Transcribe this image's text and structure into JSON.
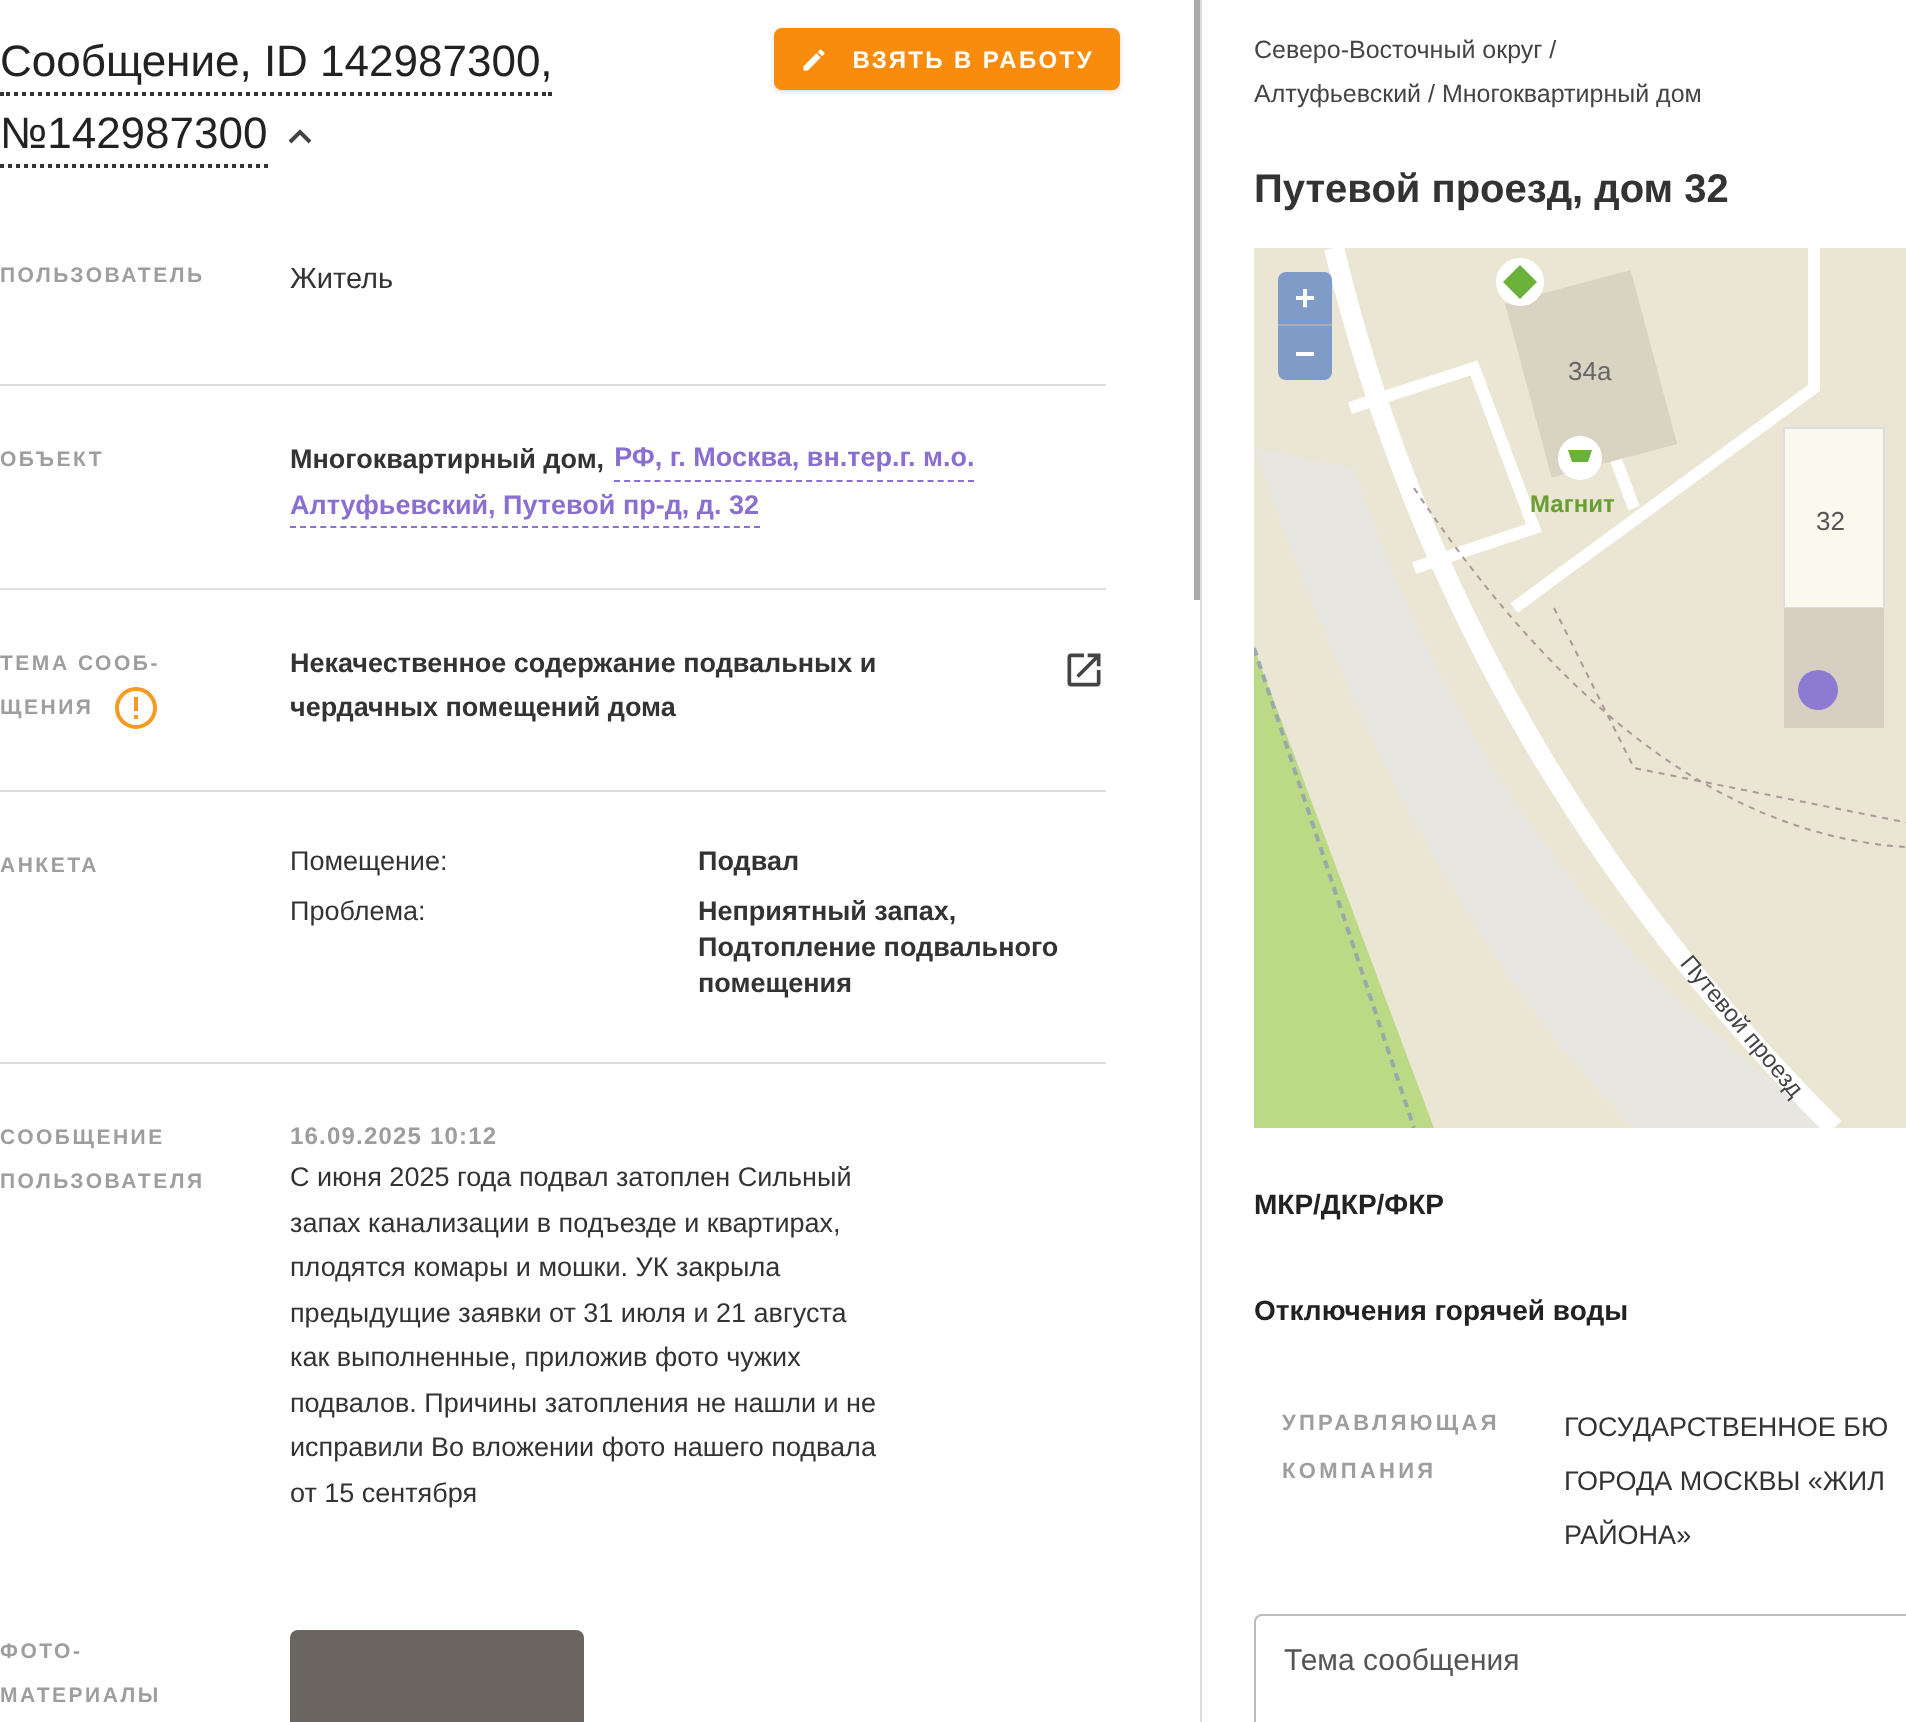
{
  "header": {
    "title_line1": "Сообщение, ID 142987300,",
    "title_line2": "№142987300",
    "expanded": true,
    "action_button": "ВЗЯТЬ В РАБОТУ"
  },
  "fields": [
    {
      "kind": "text",
      "label": [
        "ПОЛЬЗОВАТЕЛЬ"
      ],
      "value": "Житель",
      "divider": false
    },
    {
      "kind": "object",
      "label": [
        "ОБЪЕКТ"
      ],
      "value": "Многоквартирный дом,",
      "link": [
        "РФ, г. Москва, вн.тер.г. м.о.",
        "Алтуфьевский, Путевой пр-д, д. 32"
      ],
      "divider": true
    },
    {
      "kind": "topic",
      "label": [
        "ТЕМА СООБ-",
        "ЩЕНИЯ"
      ],
      "value": "Некачественное содержание подвальных и чердачных помещений дома",
      "warning": true,
      "divider": true
    },
    {
      "kind": "survey",
      "label": [
        "АНКЕТА"
      ],
      "items": [
        {
          "key": "Помещение:",
          "value": "Подвал"
        },
        {
          "key": "Проблема:",
          "value": "Неприятный запах, Подтопление подвального помещения"
        }
      ],
      "divider": true
    },
    {
      "kind": "message",
      "label": [
        "СООБЩЕНИЕ",
        "ПОЛЬЗОВАТЕЛЯ"
      ],
      "date": "16.09.2025 10:12",
      "value": "С июня 2025 года подвал затоплен Сильный запах канализации в подъезде и квартирах, плодятся комары и мошки. УК закрыла предыдущие заявки от 31 июля и 21 августа как выполненные, приложив фото чужих подвалов. Причины затопления не нашли и не исправили Во вложении фото нашего подвала от 15 сентября",
      "divider": true
    },
    {
      "kind": "photos",
      "label": [
        "ФОТО-",
        "МАТЕРИАЛЫ"
      ],
      "divider": false
    }
  ],
  "side": {
    "breadcrumb": [
      "Северо-Восточный округ /",
      "Алтуфьевский / Многоквартирный дом"
    ],
    "title": "Путевой проезд, дом 32",
    "map": {
      "zoom_in": "+",
      "zoom_out": "−",
      "building_a": "34а",
      "shop": "Магнит",
      "building_b": "32",
      "street": "Путевой проезд"
    },
    "sections": [
      "МКР/ДКР/ФКР",
      "Отключения горячей воды"
    ],
    "company": {
      "label": "УПРАВЛЯЮЩАЯ КОМПАНИЯ",
      "lines": [
        "ГОСУДАРСТВЕННОЕ БЮ",
        "ГОРОДА МОСКВЫ «ЖИЛ",
        "РАЙОНА»"
      ]
    },
    "form": {
      "placeholder": "Тема сообщения"
    }
  }
}
